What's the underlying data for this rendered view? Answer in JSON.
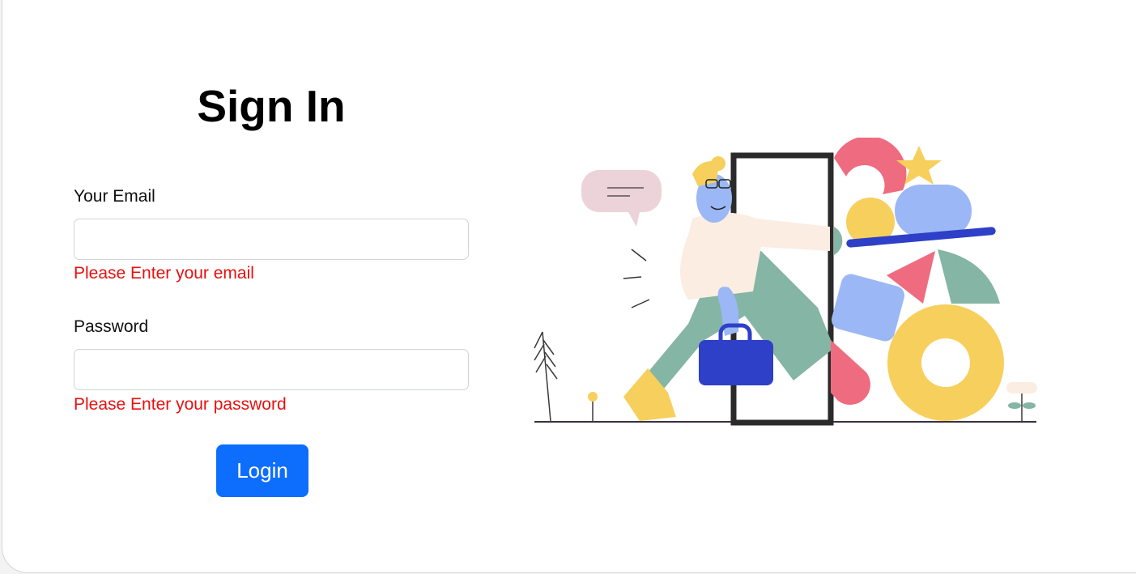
{
  "form": {
    "title": "Sign In",
    "email_label": "Your Email",
    "email_value": "",
    "email_error": "Please Enter your email",
    "password_label": "Password",
    "password_value": "",
    "password_error": "Please Enter your password",
    "login_label": "Login"
  },
  "colors": {
    "primary": "#0d6efd",
    "error": "#e8100f"
  },
  "illustration": {
    "icon": "person-entering-door-illustration"
  }
}
